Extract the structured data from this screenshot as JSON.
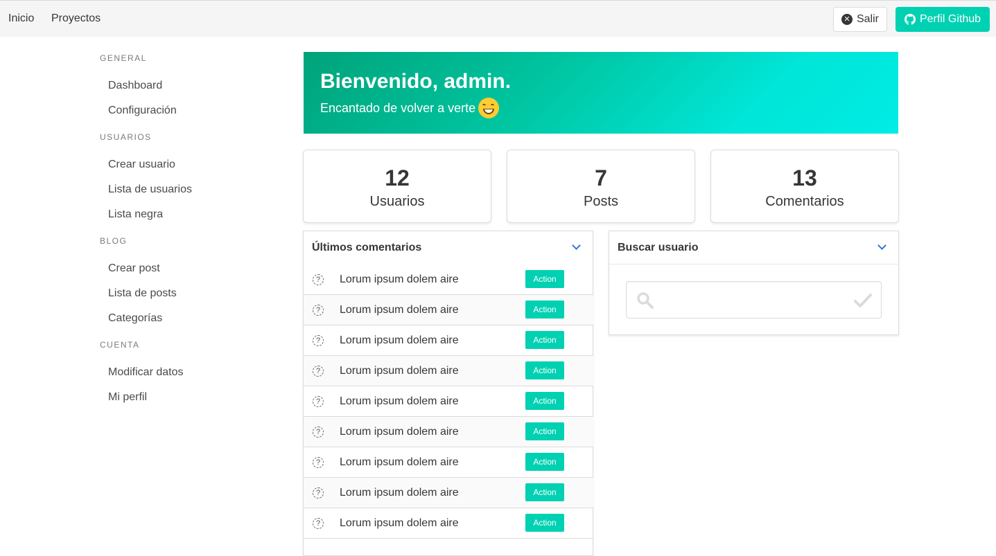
{
  "navbar": {
    "links": [
      "Inicio",
      "Proyectos"
    ],
    "logout_label": "Salir",
    "github_label": "Perfil Github"
  },
  "sidebar": {
    "sections": [
      {
        "label": "GENERAL",
        "items": [
          "Dashboard",
          "Configuración"
        ]
      },
      {
        "label": "USUARIOS",
        "items": [
          "Crear usuario",
          "Lista de usuarios",
          "Lista negra"
        ]
      },
      {
        "label": "BLOG",
        "items": [
          "Crear post",
          "Lista de posts",
          "Categorías"
        ]
      },
      {
        "label": "CUENTA",
        "items": [
          "Modificar datos",
          "Mi perfil"
        ]
      }
    ]
  },
  "hero": {
    "title": "Bienvenido, admin.",
    "subtitle": "Encantado de volver a verte",
    "emoji": "grinning-face",
    "colors": [
      "#00a37a",
      "#00ece5"
    ]
  },
  "stats": [
    {
      "value": "12",
      "label": "Usuarios"
    },
    {
      "value": "7",
      "label": "Posts"
    },
    {
      "value": "13",
      "label": "Comentarios"
    }
  ],
  "comments_card": {
    "title": "Últimos comentarios",
    "rows": [
      {
        "text": "Lorum ipsum dolem aire",
        "action": "Action"
      },
      {
        "text": "Lorum ipsum dolem aire",
        "action": "Action"
      },
      {
        "text": "Lorum ipsum dolem aire",
        "action": "Action"
      },
      {
        "text": "Lorum ipsum dolem aire",
        "action": "Action"
      },
      {
        "text": "Lorum ipsum dolem aire",
        "action": "Action"
      },
      {
        "text": "Lorum ipsum dolem aire",
        "action": "Action"
      },
      {
        "text": "Lorum ipsum dolem aire",
        "action": "Action"
      },
      {
        "text": "Lorum ipsum dolem aire",
        "action": "Action"
      },
      {
        "text": "Lorum ipsum dolem aire",
        "action": "Action"
      }
    ]
  },
  "search_card": {
    "title": "Buscar usuario",
    "placeholder": ""
  },
  "colors": {
    "primary": "#00d1b2",
    "link": "#3273dc"
  }
}
